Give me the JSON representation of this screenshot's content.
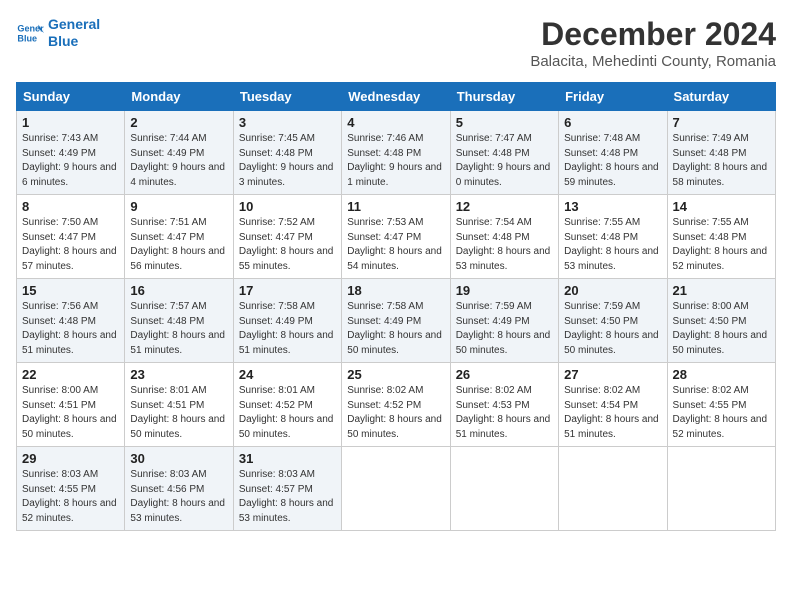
{
  "logo": {
    "line1": "General",
    "line2": "Blue"
  },
  "title": "December 2024",
  "subtitle": "Balacita, Mehedinti County, Romania",
  "headers": [
    "Sunday",
    "Monday",
    "Tuesday",
    "Wednesday",
    "Thursday",
    "Friday",
    "Saturday"
  ],
  "weeks": [
    [
      {
        "day": "1",
        "sunrise": "7:43 AM",
        "sunset": "4:49 PM",
        "daylight": "9 hours and 6 minutes."
      },
      {
        "day": "2",
        "sunrise": "7:44 AM",
        "sunset": "4:49 PM",
        "daylight": "9 hours and 4 minutes."
      },
      {
        "day": "3",
        "sunrise": "7:45 AM",
        "sunset": "4:48 PM",
        "daylight": "9 hours and 3 minutes."
      },
      {
        "day": "4",
        "sunrise": "7:46 AM",
        "sunset": "4:48 PM",
        "daylight": "9 hours and 1 minute."
      },
      {
        "day": "5",
        "sunrise": "7:47 AM",
        "sunset": "4:48 PM",
        "daylight": "9 hours and 0 minutes."
      },
      {
        "day": "6",
        "sunrise": "7:48 AM",
        "sunset": "4:48 PM",
        "daylight": "8 hours and 59 minutes."
      },
      {
        "day": "7",
        "sunrise": "7:49 AM",
        "sunset": "4:48 PM",
        "daylight": "8 hours and 58 minutes."
      }
    ],
    [
      {
        "day": "8",
        "sunrise": "7:50 AM",
        "sunset": "4:47 PM",
        "daylight": "8 hours and 57 minutes."
      },
      {
        "day": "9",
        "sunrise": "7:51 AM",
        "sunset": "4:47 PM",
        "daylight": "8 hours and 56 minutes."
      },
      {
        "day": "10",
        "sunrise": "7:52 AM",
        "sunset": "4:47 PM",
        "daylight": "8 hours and 55 minutes."
      },
      {
        "day": "11",
        "sunrise": "7:53 AM",
        "sunset": "4:47 PM",
        "daylight": "8 hours and 54 minutes."
      },
      {
        "day": "12",
        "sunrise": "7:54 AM",
        "sunset": "4:48 PM",
        "daylight": "8 hours and 53 minutes."
      },
      {
        "day": "13",
        "sunrise": "7:55 AM",
        "sunset": "4:48 PM",
        "daylight": "8 hours and 53 minutes."
      },
      {
        "day": "14",
        "sunrise": "7:55 AM",
        "sunset": "4:48 PM",
        "daylight": "8 hours and 52 minutes."
      }
    ],
    [
      {
        "day": "15",
        "sunrise": "7:56 AM",
        "sunset": "4:48 PM",
        "daylight": "8 hours and 51 minutes."
      },
      {
        "day": "16",
        "sunrise": "7:57 AM",
        "sunset": "4:48 PM",
        "daylight": "8 hours and 51 minutes."
      },
      {
        "day": "17",
        "sunrise": "7:58 AM",
        "sunset": "4:49 PM",
        "daylight": "8 hours and 51 minutes."
      },
      {
        "day": "18",
        "sunrise": "7:58 AM",
        "sunset": "4:49 PM",
        "daylight": "8 hours and 50 minutes."
      },
      {
        "day": "19",
        "sunrise": "7:59 AM",
        "sunset": "4:49 PM",
        "daylight": "8 hours and 50 minutes."
      },
      {
        "day": "20",
        "sunrise": "7:59 AM",
        "sunset": "4:50 PM",
        "daylight": "8 hours and 50 minutes."
      },
      {
        "day": "21",
        "sunrise": "8:00 AM",
        "sunset": "4:50 PM",
        "daylight": "8 hours and 50 minutes."
      }
    ],
    [
      {
        "day": "22",
        "sunrise": "8:00 AM",
        "sunset": "4:51 PM",
        "daylight": "8 hours and 50 minutes."
      },
      {
        "day": "23",
        "sunrise": "8:01 AM",
        "sunset": "4:51 PM",
        "daylight": "8 hours and 50 minutes."
      },
      {
        "day": "24",
        "sunrise": "8:01 AM",
        "sunset": "4:52 PM",
        "daylight": "8 hours and 50 minutes."
      },
      {
        "day": "25",
        "sunrise": "8:02 AM",
        "sunset": "4:52 PM",
        "daylight": "8 hours and 50 minutes."
      },
      {
        "day": "26",
        "sunrise": "8:02 AM",
        "sunset": "4:53 PM",
        "daylight": "8 hours and 51 minutes."
      },
      {
        "day": "27",
        "sunrise": "8:02 AM",
        "sunset": "4:54 PM",
        "daylight": "8 hours and 51 minutes."
      },
      {
        "day": "28",
        "sunrise": "8:02 AM",
        "sunset": "4:55 PM",
        "daylight": "8 hours and 52 minutes."
      }
    ],
    [
      {
        "day": "29",
        "sunrise": "8:03 AM",
        "sunset": "4:55 PM",
        "daylight": "8 hours and 52 minutes."
      },
      {
        "day": "30",
        "sunrise": "8:03 AM",
        "sunset": "4:56 PM",
        "daylight": "8 hours and 53 minutes."
      },
      {
        "day": "31",
        "sunrise": "8:03 AM",
        "sunset": "4:57 PM",
        "daylight": "8 hours and 53 minutes."
      },
      null,
      null,
      null,
      null
    ]
  ]
}
